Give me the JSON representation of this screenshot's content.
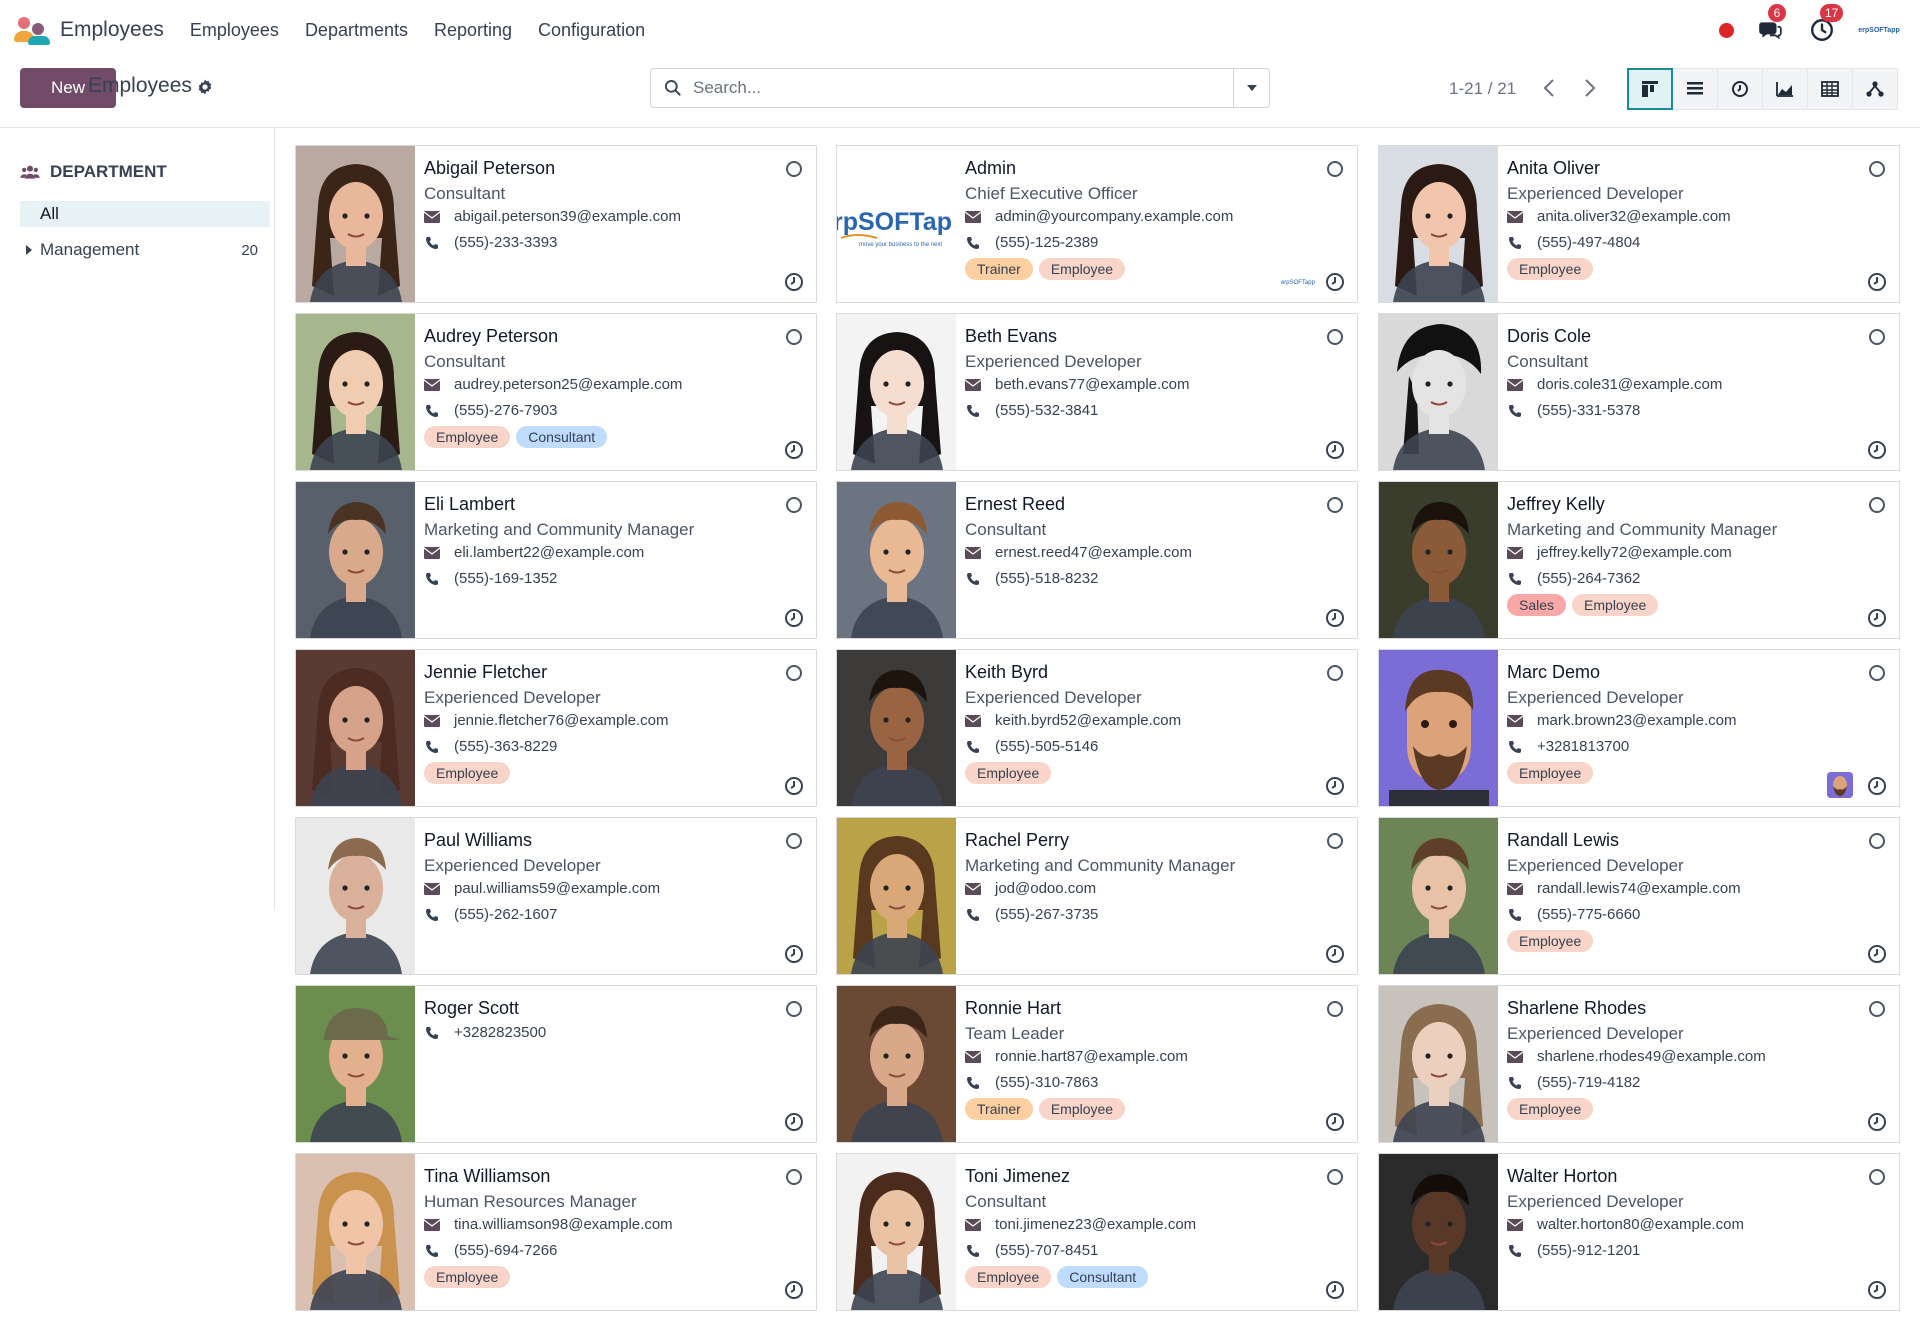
{
  "navbar": {
    "app_name": "Employees",
    "menus": [
      "Employees",
      "Departments",
      "Reporting",
      "Configuration"
    ],
    "messages_badge": "6",
    "activities_badge": "17",
    "company_logo_text": "erpSOFTapp"
  },
  "control_panel": {
    "new_label": "New",
    "title": "Employees",
    "search_placeholder": "Search...",
    "pager": "1-21 / 21",
    "views": [
      "kanban",
      "list",
      "activity",
      "graph",
      "pivot",
      "hierarchy"
    ],
    "active_view": "kanban"
  },
  "side_panel": {
    "heading": "DEPARTMENT",
    "all_label": "All",
    "departments": [
      {
        "label": "Management",
        "count": "20"
      }
    ]
  },
  "company_logo": {
    "text": "rpSOFTap",
    "tagline": "move your business to the next"
  },
  "employees": [
    {
      "name": "Abigail Peterson",
      "job": "Consultant",
      "email": "abigail.peterson39@example.com",
      "phone": "(555)-233-3393",
      "tags": [],
      "photo": "woman-curly",
      "skin": "#e8b79c",
      "hair": "#3b2418",
      "bg": "#b9a9a1"
    },
    {
      "name": "Admin",
      "job": "Chief Executive Officer",
      "email": "admin@yourcompany.example.com",
      "phone": "(555)-125-2389",
      "tags": [
        "Trainer",
        "Employee"
      ],
      "photo": "logo",
      "skin": "#ffffff",
      "hair": "#ffffff",
      "bg": "#ffffff"
    },
    {
      "name": "Anita Oliver",
      "job": "Experienced Developer",
      "email": "anita.oliver32@example.com",
      "phone": "(555)-497-4804",
      "tags": [
        "Employee"
      ],
      "photo": "woman",
      "skin": "#f1c6ad",
      "hair": "#2b1a14",
      "bg": "#d7dde2"
    },
    {
      "name": "Audrey Peterson",
      "job": "Consultant",
      "email": "audrey.peterson25@example.com",
      "phone": "(555)-276-7903",
      "tags": [
        "Employee",
        "Consultant"
      ],
      "photo": "woman",
      "skin": "#f0cdb0",
      "hair": "#2a1c14",
      "bg": "#a6b78e"
    },
    {
      "name": "Beth Evans",
      "job": "Experienced Developer",
      "email": "beth.evans77@example.com",
      "phone": "(555)-532-3841",
      "tags": [],
      "photo": "woman",
      "skin": "#f5ddd0",
      "hair": "#171313",
      "bg": "#f3f3f4"
    },
    {
      "name": "Doris Cole",
      "job": "Consultant",
      "email": "doris.cole31@example.com",
      "phone": "(555)-331-5378",
      "tags": [],
      "photo": "woman-hat",
      "skin": "#e4e4e4",
      "hair": "#151515",
      "bg": "#d9d9d9"
    },
    {
      "name": "Eli Lambert",
      "job": "Marketing and Community Manager",
      "email": "eli.lambert22@example.com",
      "phone": "(555)-169-1352",
      "tags": [],
      "photo": "man",
      "skin": "#d9a98b",
      "hair": "#4a3323",
      "bg": "#58616b"
    },
    {
      "name": "Ernest Reed",
      "job": "Consultant",
      "email": "ernest.reed47@example.com",
      "phone": "(555)-518-8232",
      "tags": [],
      "photo": "man",
      "skin": "#e8b993",
      "hair": "#8d5a33",
      "bg": "#6b7480"
    },
    {
      "name": "Jeffrey Kelly",
      "job": "Marketing and Community Manager",
      "email": "jeffrey.kelly72@example.com",
      "phone": "(555)-264-7362",
      "tags": [
        "Sales",
        "Employee"
      ],
      "photo": "man",
      "skin": "#8b5a39",
      "hair": "#1b120c",
      "bg": "#3a3d2c"
    },
    {
      "name": "Jennie Fletcher",
      "job": "Experienced Developer",
      "email": "jennie.fletcher76@example.com",
      "phone": "(555)-363-8229",
      "tags": [
        "Employee"
      ],
      "photo": "woman",
      "skin": "#d6a28a",
      "hair": "#4b2b22",
      "bg": "#5a3b34"
    },
    {
      "name": "Keith Byrd",
      "job": "Experienced Developer",
      "email": "keith.byrd52@example.com",
      "phone": "(555)-505-5146",
      "tags": [
        "Employee"
      ],
      "photo": "man",
      "skin": "#9a6442",
      "hair": "#1d140e",
      "bg": "#3d3b3a"
    },
    {
      "name": "Marc Demo",
      "job": "Experienced Developer",
      "email": "mark.brown23@example.com",
      "phone": "+3281813700",
      "tags": [
        "Employee"
      ],
      "photo": "avatar",
      "skin": "#dca27a",
      "hair": "#5a3a24",
      "bg": "#7c6cd6"
    },
    {
      "name": "Paul Williams",
      "job": "Experienced Developer",
      "email": "paul.williams59@example.com",
      "phone": "(555)-262-1607",
      "tags": [],
      "photo": "man",
      "skin": "#d9b09a",
      "hair": "#8b6a4d",
      "bg": "#e9e9e9"
    },
    {
      "name": "Rachel Perry",
      "job": "Marketing and Community Manager",
      "email": "jod@odoo.com",
      "phone": "(555)-267-3735",
      "tags": [],
      "photo": "woman",
      "skin": "#d8a878",
      "hair": "#5a3a1e",
      "bg": "#b9a248"
    },
    {
      "name": "Randall Lewis",
      "job": "Experienced Developer",
      "email": "randall.lewis74@example.com",
      "phone": "(555)-775-6660",
      "tags": [
        "Employee"
      ],
      "photo": "man",
      "skin": "#e8c2a6",
      "hair": "#5d3f2a",
      "bg": "#6d8556"
    },
    {
      "name": "Roger Scott",
      "job": "",
      "email": "",
      "phone": "+3282823500",
      "tags": [],
      "photo": "man-cap",
      "skin": "#e2b08f",
      "hair": "#6b6a4a",
      "bg": "#6b8e4e"
    },
    {
      "name": "Ronnie Hart",
      "job": "Team Leader",
      "email": "ronnie.hart87@example.com",
      "phone": "(555)-310-7863",
      "tags": [
        "Trainer",
        "Employee"
      ],
      "photo": "man",
      "skin": "#d9a888",
      "hair": "#3b2619",
      "bg": "#6b4a35"
    },
    {
      "name": "Sharlene Rhodes",
      "job": "Experienced Developer",
      "email": "sharlene.rhodes49@example.com",
      "phone": "(555)-719-4182",
      "tags": [
        "Employee"
      ],
      "photo": "woman",
      "skin": "#ecd0bd",
      "hair": "#8a6d4f",
      "bg": "#c8c2bc"
    },
    {
      "name": "Tina Williamson",
      "job": "Human Resources Manager",
      "email": "tina.williamson98@example.com",
      "phone": "(555)-694-7266",
      "tags": [
        "Employee"
      ],
      "photo": "woman",
      "skin": "#f0c4a6",
      "hair": "#c9924f",
      "bg": "#d9c0b1"
    },
    {
      "name": "Toni Jimenez",
      "job": "Consultant",
      "email": "toni.jimenez23@example.com",
      "phone": "(555)-707-8451",
      "tags": [
        "Employee",
        "Consultant"
      ],
      "photo": "woman",
      "skin": "#eac3a5",
      "hair": "#4a2b1c",
      "bg": "#f2f2f2"
    },
    {
      "name": "Walter Horton",
      "job": "Experienced Developer",
      "email": "walter.horton80@example.com",
      "phone": "(555)-912-1201",
      "tags": [],
      "photo": "man",
      "skin": "#5a3827",
      "hair": "#140d09",
      "bg": "#2b2b2b"
    }
  ]
}
